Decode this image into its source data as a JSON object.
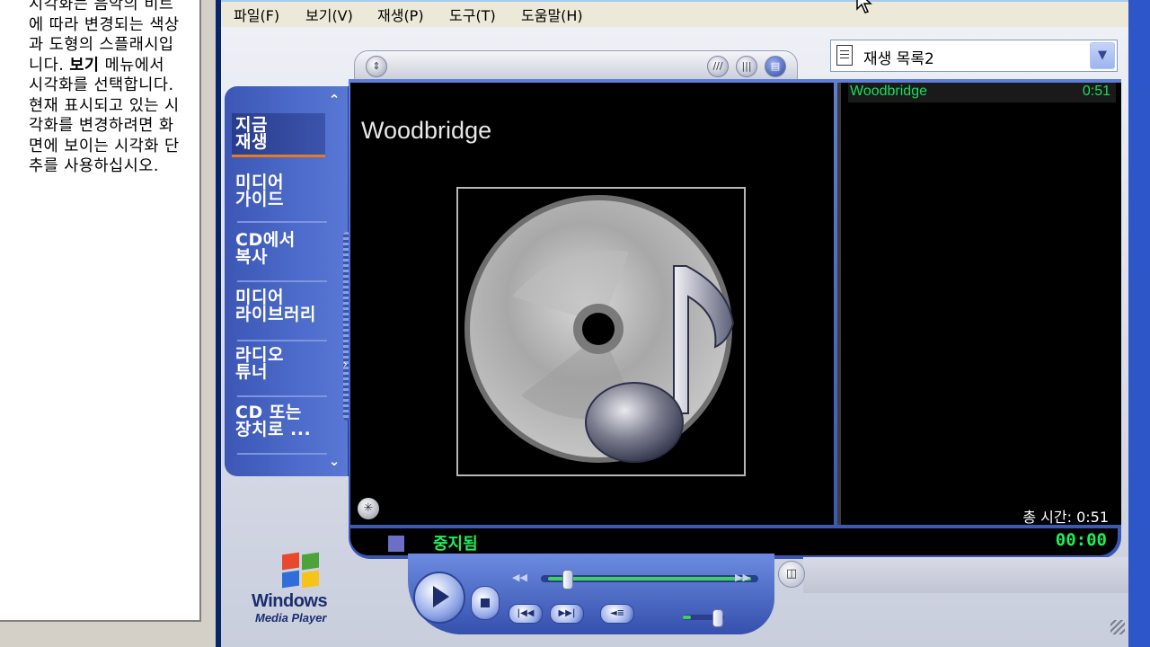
{
  "help_panel": {
    "text_lines": [
      "시각화는 음악의 비트",
      "에 따라 변경되는 색상",
      "과 도형의 스플래시입",
      "니다. ",
      "보기",
      " 메뉴에서",
      "시각화를 선택합니다.",
      "현재 표시되고 있는 시",
      "각화를 변경하려면 화",
      "면에 보이는 시각화 단",
      "추를 사용하십시오."
    ]
  },
  "menubar": {
    "items": [
      {
        "label": "파일(F)"
      },
      {
        "label": "보기(V)"
      },
      {
        "label": "재생(P)"
      },
      {
        "label": "도구(T)"
      },
      {
        "label": "도움말(H)"
      }
    ]
  },
  "taskbar": {
    "items": [
      {
        "label": "지금\n재생",
        "active": true
      },
      {
        "label": "미디어\n가이드",
        "active": false
      },
      {
        "label": "CD에서\n복사",
        "active": false
      },
      {
        "label": "미디어\n라이브러리",
        "active": false
      },
      {
        "label": "라디오\n튜너",
        "active": false
      },
      {
        "label": "CD 또는\n장치로 ...",
        "active": false
      }
    ]
  },
  "now_playing": {
    "title": "Woodbridge"
  },
  "playlist": {
    "name": "재생 목록2",
    "items": [
      {
        "title": "Woodbridge",
        "duration": "0:51"
      }
    ],
    "total_label": "총 시간:",
    "total_value": "0:51"
  },
  "status": {
    "text": "중지됨",
    "time": "00:00"
  },
  "seek": {
    "position": 0.0
  },
  "volume": {
    "level": 0.2
  },
  "logo": {
    "line1": "Windows",
    "line2": "Media Player"
  },
  "colors": {
    "skin_blue": "#4d6ccb",
    "status_green": "#1df05a",
    "menu_bg": "#ece9d8"
  }
}
